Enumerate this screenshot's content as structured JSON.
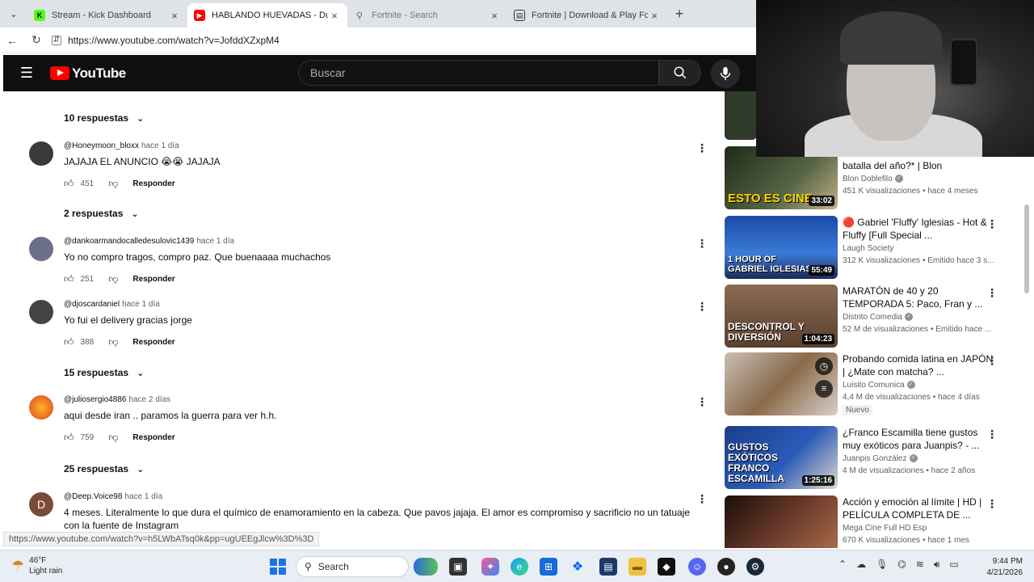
{
  "browser": {
    "tabs": [
      {
        "label": "Stream - Kick Dashboard",
        "fav": "K",
        "fav_color": "#53fc18",
        "active": false
      },
      {
        "label": "HABLANDO HUEVADAS - Duodéc",
        "fav": "▶",
        "fav_color": "#ff0000",
        "active": true
      },
      {
        "label": "Fortnite - Search",
        "fav": "🔍",
        "fav_color": "#ffffff",
        "active": false
      },
      {
        "label": "Fortnite | Download & Play For Fre",
        "fav": "▣",
        "fav_color": "#333333",
        "active": false
      }
    ],
    "url": "https://www.youtube.com/watch?v=JofddXZxpM4",
    "status_url": "https://www.youtube.com/watch?v=h5LWbATsq0k&pp=ugUEEgJlcw%3D%3D"
  },
  "youtube": {
    "logo_text": "YouTube",
    "search_placeholder": "Buscar"
  },
  "comments": {
    "replies_labels": [
      "10 respuestas",
      "2 respuestas",
      "15 respuestas",
      "25 respuestas"
    ],
    "reply_label": "Responder",
    "items": [
      {
        "user": "@Honeymoon_bloxx",
        "time": "hace 1 día",
        "text": "JAJAJA EL ANUNCIO 😭😭 JAJAJA",
        "likes": "451",
        "avatar_color": "#3a3a3a"
      },
      {
        "user": "@dankoarmandocalledesulovic1439",
        "time": "hace 1 día",
        "text": "Yo no compro tragos, compro paz. Que buenaaaa muchachos",
        "likes": "251",
        "avatar_color": "#6b6f8a"
      },
      {
        "user": "@djoscardaniel",
        "time": "hace 1 día",
        "text": "Yo fui el delivery gracias jorge",
        "likes": "388",
        "avatar_color": "#444444"
      },
      {
        "user": "@juliosergio4886",
        "time": "hace 2 días",
        "text": "aqui desde iran .. paramos la guerra para ver h.h.",
        "likes": "759",
        "avatar_color": "#d9481b"
      },
      {
        "user": "@Deep.Voice98",
        "time": "hace 1 día",
        "text": "4 meses. Literalmente lo que dura el químico de enamoramiento en la cabeza. Que pavos jajaja. El amor es compromiso y sacrificio no un tatuaje con la fuente de Instagram",
        "likes": "",
        "avatar_color": "#7a4a3a",
        "avatar_letter": "D"
      }
    ]
  },
  "sidebar": {
    "videos": [
      {
        "title": "batalla del año?* | Blon",
        "channel": "Blon Doblefilo",
        "verified": true,
        "stats": "451 K visualizaciones • hace 4 meses",
        "duration": "33:02",
        "thumb_text": "ESTO ES CINE",
        "thumb_bg": "#2e3a2a"
      },
      {
        "title": "🔴 Gabriel 'Fluffy' Iglesias - Hot & Fluffy [Full Special ...",
        "channel": "Laugh Society",
        "verified": false,
        "stats": "312 K visualizaciones • Emitido hace 3 s...",
        "duration": "55:49",
        "thumb_text": "1 HOUR OF GABRIEL IGLESIAS",
        "thumb_bg": "#1b4aa8"
      },
      {
        "title": "MARATÓN de 40 y 20 TEMPORADA 5: Paco, Fran y ...",
        "channel": "Distrito Comedia",
        "verified": true,
        "stats": "52 M de visualizaciones • Emitido hace ...",
        "duration": "1:04:23",
        "thumb_text": "DESCONTROL Y DIVERSIÓN",
        "thumb_bg": "#6a4a3a"
      },
      {
        "title": "Probando comida latina en JAPÓN | ¿Mate con matcha? ...",
        "channel": "Luisito Comunica",
        "verified": true,
        "stats": "4,4 M de visualizaciones • hace 4 días",
        "badge": "Nuevo",
        "duration": "",
        "thumb_text": "",
        "thumb_bg": "#8a7a6a"
      },
      {
        "title": "¿Franco Escamilla tiene gustos muy exóticos para Juanpis? - ...",
        "channel": "Juanpis González",
        "verified": true,
        "stats": "4 M de visualizaciones • hace 2 años",
        "duration": "1:25:16",
        "thumb_text": "GUSTOS EXÓTICOS FRANCO ESCAMILLA",
        "thumb_bg": "#1a3f8a"
      },
      {
        "title": "Acción y emoción al límite | HD | PELÍCULA COMPLETA DE ...",
        "channel": "Mega Cine Full HD Esp",
        "verified": false,
        "stats": "670 K visualizaciones • hace 1 mes",
        "duration": "",
        "thumb_text": "",
        "thumb_bg": "#3a2a22"
      }
    ]
  },
  "taskbar": {
    "weather_temp": "46°F",
    "weather_desc": "Light rain",
    "search_label": "Search",
    "time": "9:44 PM",
    "date": "4/21/2026"
  }
}
